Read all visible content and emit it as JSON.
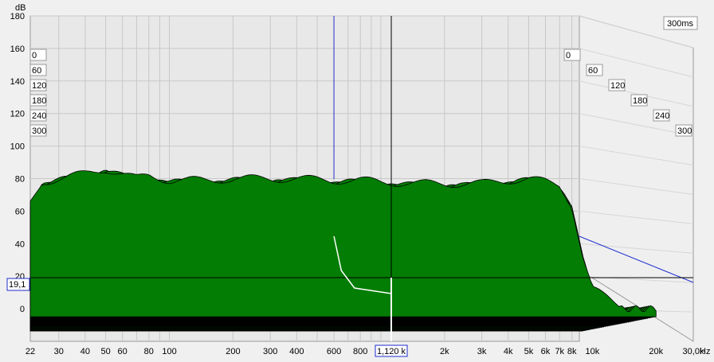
{
  "chart_data": {
    "type": "waterfall",
    "title": "",
    "ylabel": "dB",
    "xlabel_unit": "Hz",
    "x_scale": "log",
    "xlim": [
      22,
      30000
    ],
    "ylim": [
      -20,
      180
    ],
    "y_ticks": [
      "180",
      "160",
      "140",
      "120",
      "100",
      "80",
      "60",
      "40",
      "20",
      "0"
    ],
    "x_ticks": [
      {
        "label": "22",
        "hz": 22
      },
      {
        "label": "30",
        "hz": 30
      },
      {
        "label": "40",
        "hz": 40
      },
      {
        "label": "50",
        "hz": 50
      },
      {
        "label": "60",
        "hz": 60
      },
      {
        "label": "80",
        "hz": 80
      },
      {
        "label": "100",
        "hz": 100
      },
      {
        "label": "200",
        "hz": 200
      },
      {
        "label": "300",
        "hz": 300
      },
      {
        "label": "400",
        "hz": 400
      },
      {
        "label": "600",
        "hz": 600
      },
      {
        "label": "800",
        "hz": 800
      },
      {
        "label": "1,120 k",
        "hz": 1120
      },
      {
        "label": "2k",
        "hz": 2000
      },
      {
        "label": "3k",
        "hz": 3000
      },
      {
        "label": "4k",
        "hz": 4000
      },
      {
        "label": "5k",
        "hz": 5000
      },
      {
        "label": "6k",
        "hz": 6000
      },
      {
        "label": "7k",
        "hz": 7000
      },
      {
        "label": "8k",
        "hz": 8000
      },
      {
        "label": "10k",
        "hz": 10000
      },
      {
        "label": "20k",
        "hz": 20000
      },
      {
        "label": "30,0k",
        "hz": 30000
      }
    ],
    "time_slices_ms": [
      0,
      60,
      120,
      180,
      240,
      300
    ],
    "time_labels": [
      "0",
      "60",
      "120",
      "180",
      "240",
      "300"
    ],
    "time_range_label": "300ms",
    "cursor": {
      "freq_label": "1,120 k",
      "freq_hz": 1120,
      "level_label": "19,1",
      "level_db": 19.1
    },
    "envelope_hz": [
      22,
      25,
      30,
      40,
      50,
      60,
      70,
      80,
      100,
      150,
      200,
      300,
      400,
      600,
      800,
      1000,
      1500,
      2000,
      3000,
      4000,
      5000,
      6000,
      7000,
      8000,
      9000,
      10000,
      20000
    ],
    "envelope_db": [
      65,
      78,
      80,
      83,
      86,
      83,
      80,
      82,
      79,
      79,
      80,
      80,
      80,
      79,
      79,
      78,
      77,
      77,
      77,
      79,
      80,
      78,
      76,
      64,
      32,
      12,
      -10
    ],
    "colors": {
      "fill": "#037d03",
      "edge": "#000000",
      "background": "#f0f0f0",
      "plot": "#e8e8e8",
      "cursor_line": "#000000",
      "blue_line": "#2232d2",
      "white_line": "#ffffff"
    }
  }
}
